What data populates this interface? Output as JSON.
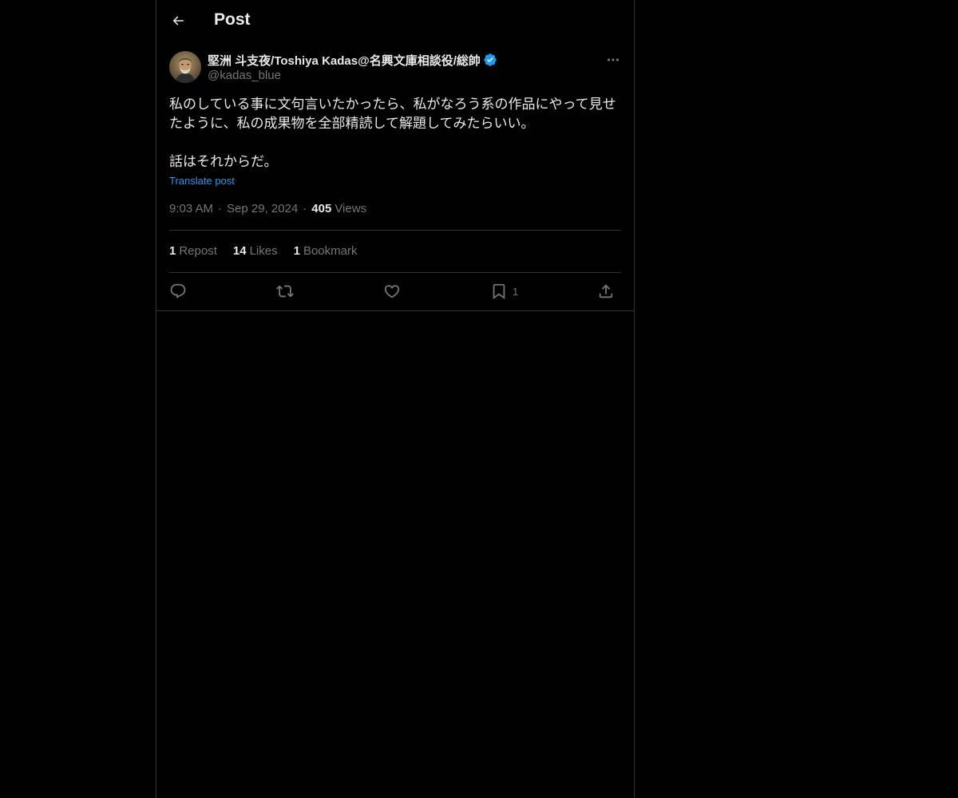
{
  "header": {
    "title": "Post",
    "back_icon": "arrow-left-icon"
  },
  "post": {
    "author": {
      "name": "堅洲 斗支夜/Toshiya Kadas@名興文庫相談役/総帥",
      "handle": "@kadas_blue",
      "verified": true,
      "verified_color": "#1d9bf0"
    },
    "text_line1": "私のしている事に文句言いたかったら、私がなろう系の作品にやって見せ",
    "text_line2": "たように、私の成果物を全部精読して解題してみたらいい。",
    "text_line3": "話はそれからだ。",
    "translate_label": "Translate post",
    "time": "9:03 AM",
    "date": "Sep 29, 2024",
    "views_count": "405",
    "views_label": "Views",
    "stats": {
      "reposts_count": "1",
      "reposts_label": "Repost",
      "likes_count": "14",
      "likes_label": "Likes",
      "bookmarks_count": "1",
      "bookmarks_label": "Bookmark"
    },
    "actions": {
      "reply_icon": "reply-icon",
      "repost_icon": "repost-icon",
      "like_icon": "heart-icon",
      "bookmark_icon": "bookmark-icon",
      "bookmark_count": "1",
      "share_icon": "share-icon"
    }
  },
  "colors": {
    "background": "#000000",
    "text_primary": "#e7e9ea",
    "text_secondary": "#71767b",
    "accent": "#1d9bf0",
    "border": "#2f3336"
  }
}
